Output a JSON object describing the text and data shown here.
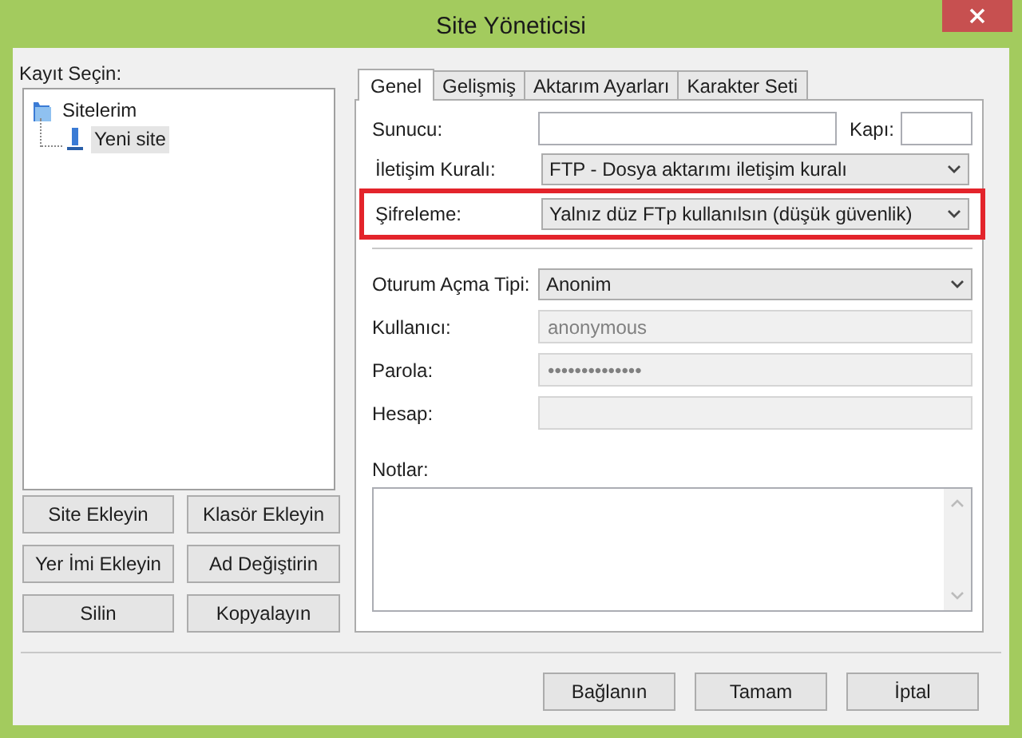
{
  "window": {
    "title": "Site Yöneticisi"
  },
  "left": {
    "label": "Kayıt Seçin:",
    "tree": [
      {
        "label": "Sitelerim",
        "kind": "folder",
        "selected": false,
        "children": [
          {
            "label": "Yeni site",
            "kind": "site",
            "selected": true
          }
        ]
      }
    ],
    "buttons": [
      "Site Ekleyin",
      "Klasör Ekleyin",
      "Yer İmi Ekleyin",
      "Ad Değiştirin",
      "Silin",
      "Kopyalayın"
    ]
  },
  "tabs": [
    {
      "label": "Genel",
      "selected": true
    },
    {
      "label": "Gelişmiş",
      "selected": false
    },
    {
      "label": "Aktarım Ayarları",
      "selected": false
    },
    {
      "label": "Karakter Seti",
      "selected": false
    }
  ],
  "form": {
    "host": {
      "label": "Sunucu:"
    },
    "port": {
      "label": "Kapı:"
    },
    "protocol": {
      "label": "İletişim Kuralı:",
      "value": "FTP - Dosya aktarımı iletişim kuralı"
    },
    "encryption": {
      "label": "Şifreleme:",
      "value": "Yalnız düz FTp kullanılsın (düşük güvenlik)",
      "highlighted": true
    },
    "logon_type": {
      "label": "Oturum Açma Tipi:",
      "value": "Anonim"
    },
    "user": {
      "label": "Kullanıcı:",
      "value": "anonymous",
      "disabled": true
    },
    "password": {
      "label": "Parola:",
      "value": "••••••••••••••",
      "disabled": true
    },
    "account": {
      "label": "Hesap:",
      "disabled": true
    },
    "notes": {
      "label": "Notlar:"
    }
  },
  "buttons": [
    "Bağlanın",
    "Tamam",
    "İptal"
  ]
}
